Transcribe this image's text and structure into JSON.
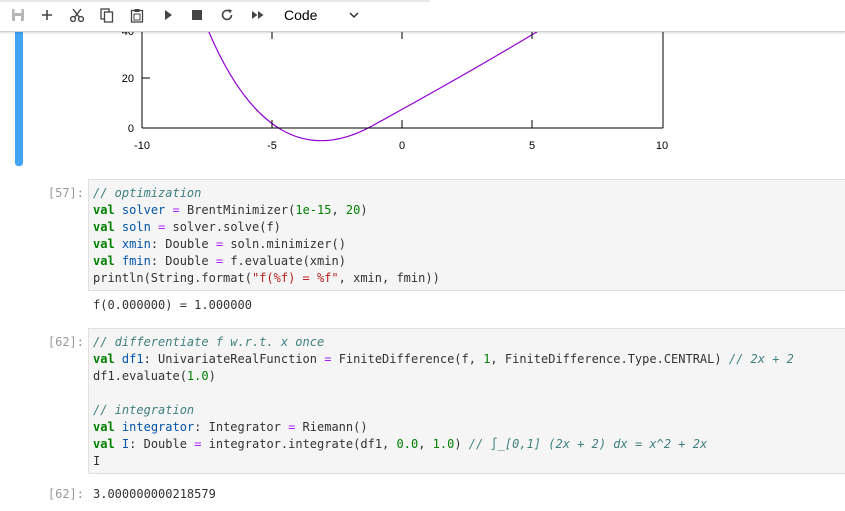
{
  "toolbar": {
    "buttons": [
      {
        "name": "save-icon"
      },
      {
        "name": "plus-icon"
      },
      {
        "name": "scissors-icon"
      },
      {
        "name": "copy-icon"
      },
      {
        "name": "paste-icon"
      },
      {
        "name": "run-icon"
      },
      {
        "name": "stop-icon"
      },
      {
        "name": "restart-icon"
      },
      {
        "name": "fast-forward-icon"
      }
    ],
    "cell_type": "Code"
  },
  "plot": {
    "y_ticks": [
      "20",
      "0"
    ],
    "x_ticks": [
      "-10",
      "-5",
      "0",
      "5",
      "10"
    ],
    "partial_top_label": "40"
  },
  "cells": [
    {
      "prompt": "[57]:",
      "code": [
        "// optimization",
        "val solver = BrentMinimizer(1e-15, 20)",
        "val soln = solver.solve(f)",
        "val xmin: Double = soln.minimizer()",
        "val fmin: Double = f.evaluate(xmin)",
        "println(String.format(\"f(%f) = %f\", xmin, fmin))"
      ],
      "output": "f(0.000000) = 1.000000"
    },
    {
      "prompt": "[62]:",
      "code": [
        "// differentiate f w.r.t. x once",
        "val df1: UnivariateRealFunction = FiniteDifference(f, 1, FiniteDifference.Type.CENTRAL) // 2x + 2",
        "df1.evaluate(1.0)",
        "",
        "// integration",
        "val integrator: Integrator = Riemann()",
        "val I: Double = integrator.integrate(df1, 0.0, 1.0) // ∫_[0,1] (2x + 2) dx = x^2 + 2x",
        "I"
      ],
      "output_prompt": "[62]:",
      "output": "3.000000000218579"
    }
  ]
}
